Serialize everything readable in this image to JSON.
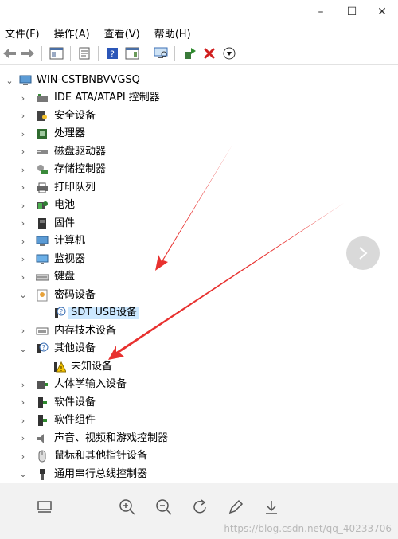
{
  "menu": [
    "文件(F)",
    "操作(A)",
    "查看(V)",
    "帮助(H)"
  ],
  "window_controls": {
    "minimize": "–",
    "maximize": "☐",
    "close": "✕"
  },
  "tree": {
    "root": "WIN-CSTBNBVVGSQ",
    "items": [
      {
        "label": "IDE ATA/ATAPI 控制器",
        "icon": "ide-controller-icon",
        "state": "collapsed"
      },
      {
        "label": "安全设备",
        "icon": "security-device-icon",
        "state": "collapsed"
      },
      {
        "label": "处理器",
        "icon": "processor-icon",
        "state": "collapsed"
      },
      {
        "label": "磁盘驱动器",
        "icon": "disk-drive-icon",
        "state": "collapsed"
      },
      {
        "label": "存储控制器",
        "icon": "storage-controller-icon",
        "state": "collapsed"
      },
      {
        "label": "打印队列",
        "icon": "printer-icon",
        "state": "collapsed"
      },
      {
        "label": "电池",
        "icon": "battery-icon",
        "state": "collapsed"
      },
      {
        "label": "固件",
        "icon": "firmware-icon",
        "state": "collapsed"
      },
      {
        "label": "计算机",
        "icon": "computer-icon",
        "state": "collapsed"
      },
      {
        "label": "监视器",
        "icon": "monitor-icon",
        "state": "collapsed"
      },
      {
        "label": "键盘",
        "icon": "keyboard-icon",
        "state": "collapsed"
      },
      {
        "label": "密码设备",
        "icon": "crypto-device-icon",
        "state": "expanded",
        "children": [
          {
            "label": "SDT USB设备",
            "icon": "unknown-device-icon",
            "selected": true
          }
        ]
      },
      {
        "label": "内存技术设备",
        "icon": "memory-device-icon",
        "state": "collapsed"
      },
      {
        "label": "其他设备",
        "icon": "other-devices-icon",
        "state": "expanded",
        "children": [
          {
            "label": "未知设备",
            "icon": "warning-device-icon",
            "selected": false
          }
        ]
      },
      {
        "label": "人体学输入设备",
        "icon": "hid-icon",
        "state": "collapsed"
      },
      {
        "label": "软件设备",
        "icon": "software-device-icon",
        "state": "collapsed"
      },
      {
        "label": "软件组件",
        "icon": "software-component-icon",
        "state": "collapsed"
      },
      {
        "label": "声音、视频和游戏控制器",
        "icon": "sound-icon",
        "state": "collapsed"
      },
      {
        "label": "鼠标和其他指针设备",
        "icon": "mouse-icon",
        "state": "collapsed"
      },
      {
        "label": "通用串行总线控制器",
        "icon": "usb-icon",
        "state": "collapsed"
      }
    ]
  },
  "watermark": "https://blog.csdn.net/qq_40233706",
  "colors": {
    "selected_bg": "#cce8ff",
    "arrow": "#e8312f",
    "bottom_bar": "#f2f2f2"
  }
}
